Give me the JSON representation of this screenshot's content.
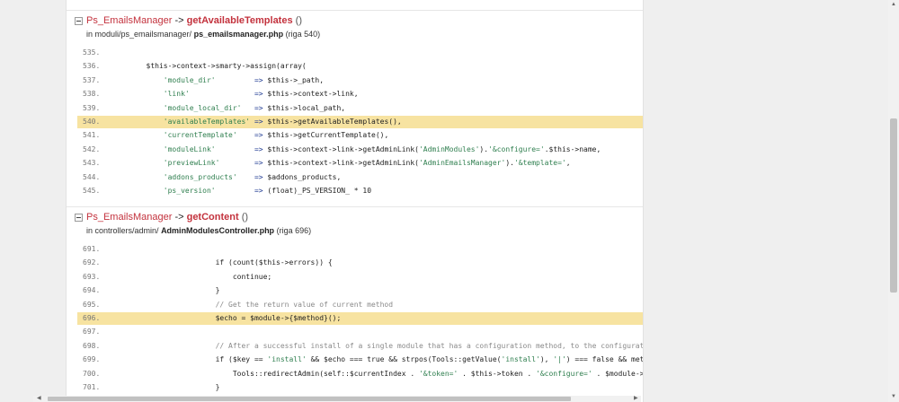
{
  "frames": [
    {
      "class": "Ps_EmailsManager",
      "arrow": "->",
      "method": "getAvailableTemplates",
      "parens": "()",
      "path_prefix": "in moduli/ps_emailsmanager/",
      "file": "ps_emailsmanager.php",
      "line_ref": "(riga 540)",
      "lines": [
        {
          "n": "535.",
          "code": ""
        },
        {
          "n": "536.",
          "code": "        $this->context->smarty->assign(array("
        },
        {
          "n": "537.",
          "code": "            'module_dir'         => $this->_path,"
        },
        {
          "n": "538.",
          "code": "            'link'               => $this->context->link,"
        },
        {
          "n": "539.",
          "code": "            'module_local_dir'   => $this->local_path,"
        },
        {
          "n": "540.",
          "code": "            'availableTemplates' => $this->getAvailableTemplates(),"
        },
        {
          "n": "541.",
          "code": "            'currentTemplate'    => $this->getCurrentTemplate(),"
        },
        {
          "n": "542.",
          "code": "            'moduleLink'         => $this->context->link->getAdminLink('AdminModules').'&configure='.$this->name,"
        },
        {
          "n": "543.",
          "code": "            'previewLink'        => $this->context->link->getAdminLink('AdminEmailsManager').'&template=',"
        },
        {
          "n": "544.",
          "code": "            'addons_products'    => $addons_products,"
        },
        {
          "n": "545.",
          "code": "            'ps_version'         => (float)_PS_VERSION_ * 10"
        }
      ]
    },
    {
      "class": "Ps_EmailsManager",
      "arrow": "->",
      "method": "getContent",
      "parens": "()",
      "path_prefix": "in controllers/admin/",
      "file": "AdminModulesController.php",
      "line_ref": "(riga 696)",
      "lines": [
        {
          "n": "691.",
          "code": ""
        },
        {
          "n": "692.",
          "code": "                        if (count($this->errors)) {"
        },
        {
          "n": "693.",
          "code": "                            continue;"
        },
        {
          "n": "694.",
          "code": "                        }"
        },
        {
          "n": "695.",
          "code": "                        // Get the return value of current method"
        },
        {
          "n": "696.",
          "code": "                        $echo = $module->{$method}();"
        },
        {
          "n": "697.",
          "code": ""
        },
        {
          "n": "698.",
          "code": "                        // After a successful install of a single module that has a configuration method, to the configuration page"
        },
        {
          "n": "699.",
          "code": "                        if ($key == 'install' && $echo === true && strpos(Tools::getValue('install'), '|') === false && method_exist"
        },
        {
          "n": "700.",
          "code": "                            Tools::redirectAdmin(self::$currentIndex . '&token=' . $this->token . '&configure=' . $module->name . '&"
        },
        {
          "n": "701.",
          "code": "                        }"
        }
      ]
    }
  ],
  "highlighted": [
    "540.",
    "696."
  ],
  "colors": {
    "highlight": "#f7e3a1",
    "class_name": "#c3323d",
    "string": "#2f7f4f",
    "comment": "#8a8a8a"
  }
}
